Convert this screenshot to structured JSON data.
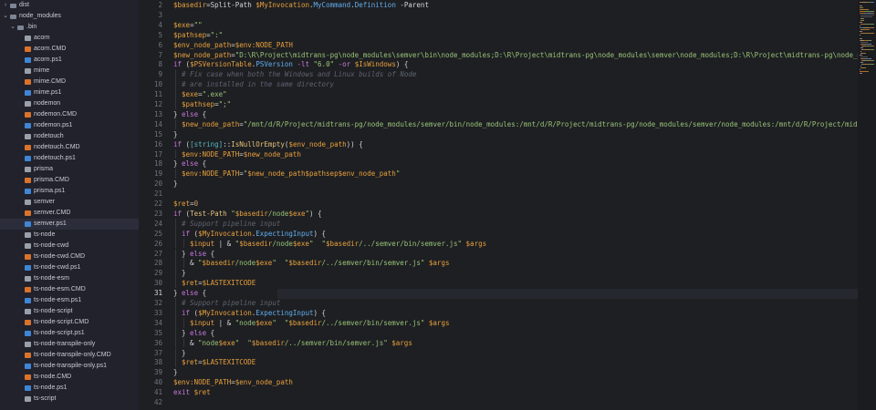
{
  "sidebar": {
    "items": [
      {
        "label": "dist",
        "depth": 0,
        "kind": "folder",
        "chevron": "right"
      },
      {
        "label": "node_modules",
        "depth": 0,
        "kind": "folder",
        "chevron": "down"
      },
      {
        "label": ".bin",
        "depth": 1,
        "kind": "folder",
        "chevron": "down"
      },
      {
        "label": "acorn",
        "depth": 2,
        "kind": "file"
      },
      {
        "label": "acorn.CMD",
        "depth": 2,
        "kind": "cmd"
      },
      {
        "label": "acorn.ps1",
        "depth": 2,
        "kind": "ps1"
      },
      {
        "label": "mime",
        "depth": 2,
        "kind": "file"
      },
      {
        "label": "mime.CMD",
        "depth": 2,
        "kind": "cmd"
      },
      {
        "label": "mime.ps1",
        "depth": 2,
        "kind": "ps1"
      },
      {
        "label": "nodemon",
        "depth": 2,
        "kind": "file"
      },
      {
        "label": "nodemon.CMD",
        "depth": 2,
        "kind": "cmd"
      },
      {
        "label": "nodemon.ps1",
        "depth": 2,
        "kind": "ps1"
      },
      {
        "label": "nodetouch",
        "depth": 2,
        "kind": "file"
      },
      {
        "label": "nodetouch.CMD",
        "depth": 2,
        "kind": "cmd"
      },
      {
        "label": "nodetouch.ps1",
        "depth": 2,
        "kind": "ps1"
      },
      {
        "label": "prisma",
        "depth": 2,
        "kind": "file"
      },
      {
        "label": "prisma.CMD",
        "depth": 2,
        "kind": "cmd"
      },
      {
        "label": "prisma.ps1",
        "depth": 2,
        "kind": "ps1"
      },
      {
        "label": "semver",
        "depth": 2,
        "kind": "file"
      },
      {
        "label": "semver.CMD",
        "depth": 2,
        "kind": "cmd"
      },
      {
        "label": "semver.ps1",
        "depth": 2,
        "kind": "ps1",
        "selected": true
      },
      {
        "label": "ts-node",
        "depth": 2,
        "kind": "file"
      },
      {
        "label": "ts-node-cwd",
        "depth": 2,
        "kind": "file"
      },
      {
        "label": "ts-node-cwd.CMD",
        "depth": 2,
        "kind": "cmd"
      },
      {
        "label": "ts-node-cwd.ps1",
        "depth": 2,
        "kind": "ps1"
      },
      {
        "label": "ts-node-esm",
        "depth": 2,
        "kind": "file"
      },
      {
        "label": "ts-node-esm.CMD",
        "depth": 2,
        "kind": "cmd"
      },
      {
        "label": "ts-node-esm.ps1",
        "depth": 2,
        "kind": "ps1"
      },
      {
        "label": "ts-node-script",
        "depth": 2,
        "kind": "file"
      },
      {
        "label": "ts-node-script.CMD",
        "depth": 2,
        "kind": "cmd"
      },
      {
        "label": "ts-node-script.ps1",
        "depth": 2,
        "kind": "ps1"
      },
      {
        "label": "ts-node-transpile-only",
        "depth": 2,
        "kind": "file"
      },
      {
        "label": "ts-node-transpile-only.CMD",
        "depth": 2,
        "kind": "cmd"
      },
      {
        "label": "ts-node-transpile-only.ps1",
        "depth": 2,
        "kind": "ps1"
      },
      {
        "label": "ts-node.CMD",
        "depth": 2,
        "kind": "cmd"
      },
      {
        "label": "ts-node.ps1",
        "depth": 2,
        "kind": "ps1"
      },
      {
        "label": "ts-script",
        "depth": 2,
        "kind": "file"
      }
    ]
  },
  "editor": {
    "active_line": 31,
    "lines": [
      {
        "n": 2,
        "indent": 0,
        "t": [
          [
            "var",
            "$basedir"
          ],
          [
            "plain",
            "=Split-Path "
          ],
          [
            "var",
            "$MyInvocation"
          ],
          [
            "plain",
            "."
          ],
          [
            "mem",
            "MyCommand"
          ],
          [
            "plain",
            "."
          ],
          [
            "mem",
            "Definition"
          ],
          [
            "plain",
            " -Parent"
          ]
        ]
      },
      {
        "n": 3,
        "indent": 0,
        "t": []
      },
      {
        "n": 4,
        "indent": 0,
        "t": [
          [
            "var",
            "$exe"
          ],
          [
            "plain",
            "="
          ],
          [
            "str",
            "\"\""
          ]
        ]
      },
      {
        "n": 5,
        "indent": 0,
        "t": [
          [
            "var",
            "$pathsep"
          ],
          [
            "plain",
            "="
          ],
          [
            "str",
            "\":\""
          ]
        ]
      },
      {
        "n": 6,
        "indent": 0,
        "t": [
          [
            "var",
            "$env_node_path"
          ],
          [
            "plain",
            "="
          ],
          [
            "var",
            "$env:NODE_PATH"
          ]
        ]
      },
      {
        "n": 7,
        "indent": 0,
        "t": [
          [
            "var",
            "$new_node_path"
          ],
          [
            "plain",
            "="
          ],
          [
            "str",
            "\"D:\\R\\Project\\midtrans-pg\\node_modules\\semver\\bin\\node_modules;D:\\R\\Project\\midtrans-pg\\node_modules\\semver\\node_modules;D:\\R\\Project\\midtrans-pg\\node_m"
          ]
        ]
      },
      {
        "n": 8,
        "indent": 0,
        "t": [
          [
            "kw",
            "if"
          ],
          [
            "plain",
            " ("
          ],
          [
            "var",
            "$PSVersionTable"
          ],
          [
            "plain",
            "."
          ],
          [
            "mem",
            "PSVersion"
          ],
          [
            "plain",
            " "
          ],
          [
            "op",
            "-lt"
          ],
          [
            "plain",
            " "
          ],
          [
            "str",
            "\"6.0\""
          ],
          [
            "plain",
            " "
          ],
          [
            "op",
            "-or"
          ],
          [
            "plain",
            " "
          ],
          [
            "var",
            "$IsWindows"
          ],
          [
            "plain",
            ") {"
          ]
        ]
      },
      {
        "n": 9,
        "indent": 1,
        "t": [
          [
            "cmt",
            "# Fix case when both the Windows and Linux builds of Node"
          ]
        ]
      },
      {
        "n": 10,
        "indent": 1,
        "t": [
          [
            "cmt",
            "# are installed in the same directory"
          ]
        ]
      },
      {
        "n": 11,
        "indent": 1,
        "t": [
          [
            "var",
            "$exe"
          ],
          [
            "plain",
            "="
          ],
          [
            "str",
            "\".exe\""
          ]
        ]
      },
      {
        "n": 12,
        "indent": 1,
        "t": [
          [
            "var",
            "$pathsep"
          ],
          [
            "plain",
            "="
          ],
          [
            "str",
            "\";\""
          ]
        ]
      },
      {
        "n": 13,
        "indent": 0,
        "t": [
          [
            "plain",
            "} "
          ],
          [
            "kw",
            "else"
          ],
          [
            "plain",
            " {"
          ]
        ]
      },
      {
        "n": 14,
        "indent": 1,
        "t": [
          [
            "var",
            "$new_node_path"
          ],
          [
            "plain",
            "="
          ],
          [
            "str",
            "\"/mnt/d/R/Project/midtrans-pg/node_modules/semver/bin/node_modules:/mnt/d/R/Project/midtrans-pg/node_modules/semver/node_modules:/mnt/d/R/Project/midt"
          ]
        ]
      },
      {
        "n": 15,
        "indent": 0,
        "t": [
          [
            "plain",
            "}"
          ]
        ]
      },
      {
        "n": 16,
        "indent": 0,
        "t": [
          [
            "kw",
            "if"
          ],
          [
            "plain",
            " ("
          ],
          [
            "type",
            "[string]"
          ],
          [
            "plain",
            "::"
          ],
          [
            "fn",
            "IsNullOrEmpty"
          ],
          [
            "plain",
            "("
          ],
          [
            "var",
            "$env_node_path"
          ],
          [
            "plain",
            ")) {"
          ]
        ]
      },
      {
        "n": 17,
        "indent": 1,
        "t": [
          [
            "var",
            "$env:NODE_PATH"
          ],
          [
            "plain",
            "="
          ],
          [
            "var",
            "$new_node_path"
          ]
        ]
      },
      {
        "n": 18,
        "indent": 0,
        "t": [
          [
            "plain",
            "} "
          ],
          [
            "kw",
            "else"
          ],
          [
            "plain",
            " {"
          ]
        ]
      },
      {
        "n": 19,
        "indent": 1,
        "t": [
          [
            "var",
            "$env:NODE_PATH"
          ],
          [
            "plain",
            "="
          ],
          [
            "str",
            "\""
          ],
          [
            "var",
            "$new_node_path$pathsep$env_node_path"
          ],
          [
            "str",
            "\""
          ]
        ]
      },
      {
        "n": 20,
        "indent": 0,
        "t": [
          [
            "plain",
            "}"
          ]
        ]
      },
      {
        "n": 21,
        "indent": 0,
        "t": []
      },
      {
        "n": 22,
        "indent": 0,
        "t": [
          [
            "var",
            "$ret"
          ],
          [
            "plain",
            "="
          ],
          [
            "num",
            "0"
          ]
        ]
      },
      {
        "n": 23,
        "indent": 0,
        "t": [
          [
            "kw",
            "if"
          ],
          [
            "plain",
            " ("
          ],
          [
            "fn",
            "Test-Path"
          ],
          [
            "plain",
            " "
          ],
          [
            "str",
            "\""
          ],
          [
            "var",
            "$basedir"
          ],
          [
            "str",
            "/node"
          ],
          [
            "var",
            "$exe"
          ],
          [
            "str",
            "\""
          ],
          [
            "plain",
            ") {"
          ]
        ]
      },
      {
        "n": 24,
        "indent": 1,
        "t": [
          [
            "cmt",
            "# Support pipeline input"
          ]
        ]
      },
      {
        "n": 25,
        "indent": 1,
        "t": [
          [
            "kw",
            "if"
          ],
          [
            "plain",
            " ("
          ],
          [
            "var",
            "$MyInvocation"
          ],
          [
            "plain",
            "."
          ],
          [
            "mem",
            "ExpectingInput"
          ],
          [
            "plain",
            ") {"
          ]
        ]
      },
      {
        "n": 26,
        "indent": 2,
        "t": [
          [
            "var",
            "$input"
          ],
          [
            "plain",
            " | & "
          ],
          [
            "str",
            "\""
          ],
          [
            "var",
            "$basedir"
          ],
          [
            "str",
            "/node"
          ],
          [
            "var",
            "$exe"
          ],
          [
            "str",
            "\""
          ],
          [
            "plain",
            "  "
          ],
          [
            "str",
            "\""
          ],
          [
            "var",
            "$basedir"
          ],
          [
            "str",
            "/../semver/bin/semver.js\""
          ],
          [
            "plain",
            " "
          ],
          [
            "var",
            "$args"
          ]
        ]
      },
      {
        "n": 27,
        "indent": 1,
        "t": [
          [
            "plain",
            "} "
          ],
          [
            "kw",
            "else"
          ],
          [
            "plain",
            " {"
          ]
        ]
      },
      {
        "n": 28,
        "indent": 2,
        "t": [
          [
            "plain",
            "& "
          ],
          [
            "str",
            "\""
          ],
          [
            "var",
            "$basedir"
          ],
          [
            "str",
            "/node"
          ],
          [
            "var",
            "$exe"
          ],
          [
            "str",
            "\""
          ],
          [
            "plain",
            "  "
          ],
          [
            "str",
            "\""
          ],
          [
            "var",
            "$basedir"
          ],
          [
            "str",
            "/../semver/bin/semver.js\""
          ],
          [
            "plain",
            " "
          ],
          [
            "var",
            "$args"
          ]
        ]
      },
      {
        "n": 29,
        "indent": 1,
        "t": [
          [
            "plain",
            "}"
          ]
        ]
      },
      {
        "n": 30,
        "indent": 1,
        "t": [
          [
            "var",
            "$ret"
          ],
          [
            "plain",
            "="
          ],
          [
            "var",
            "$LASTEXITCODE"
          ]
        ]
      },
      {
        "n": 31,
        "indent": 0,
        "t": [
          [
            "plain",
            "} "
          ],
          [
            "kw",
            "else"
          ],
          [
            "plain",
            " {"
          ]
        ]
      },
      {
        "n": 32,
        "indent": 1,
        "t": [
          [
            "cmt",
            "# Support pipeline input"
          ]
        ]
      },
      {
        "n": 33,
        "indent": 1,
        "t": [
          [
            "kw",
            "if"
          ],
          [
            "plain",
            " ("
          ],
          [
            "var",
            "$MyInvocation"
          ],
          [
            "plain",
            "."
          ],
          [
            "mem",
            "ExpectingInput"
          ],
          [
            "plain",
            ") {"
          ]
        ]
      },
      {
        "n": 34,
        "indent": 2,
        "t": [
          [
            "var",
            "$input"
          ],
          [
            "plain",
            " | & "
          ],
          [
            "str",
            "\"node"
          ],
          [
            "var",
            "$exe"
          ],
          [
            "str",
            "\""
          ],
          [
            "plain",
            "  "
          ],
          [
            "str",
            "\""
          ],
          [
            "var",
            "$basedir"
          ],
          [
            "str",
            "/../semver/bin/semver.js\""
          ],
          [
            "plain",
            " "
          ],
          [
            "var",
            "$args"
          ]
        ]
      },
      {
        "n": 35,
        "indent": 1,
        "t": [
          [
            "plain",
            "} "
          ],
          [
            "kw",
            "else"
          ],
          [
            "plain",
            " {"
          ]
        ]
      },
      {
        "n": 36,
        "indent": 2,
        "t": [
          [
            "plain",
            "& "
          ],
          [
            "str",
            "\"node"
          ],
          [
            "var",
            "$exe"
          ],
          [
            "str",
            "\""
          ],
          [
            "plain",
            "  "
          ],
          [
            "str",
            "\""
          ],
          [
            "var",
            "$basedir"
          ],
          [
            "str",
            "/../semver/bin/semver.js\""
          ],
          [
            "plain",
            " "
          ],
          [
            "var",
            "$args"
          ]
        ]
      },
      {
        "n": 37,
        "indent": 1,
        "t": [
          [
            "plain",
            "}"
          ]
        ]
      },
      {
        "n": 38,
        "indent": 1,
        "t": [
          [
            "var",
            "$ret"
          ],
          [
            "plain",
            "="
          ],
          [
            "var",
            "$LASTEXITCODE"
          ]
        ]
      },
      {
        "n": 39,
        "indent": 0,
        "t": [
          [
            "plain",
            "}"
          ]
        ]
      },
      {
        "n": 40,
        "indent": 0,
        "t": [
          [
            "var",
            "$env:NODE_PATH"
          ],
          [
            "plain",
            "="
          ],
          [
            "var",
            "$env_node_path"
          ]
        ]
      },
      {
        "n": 41,
        "indent": 0,
        "t": [
          [
            "kw",
            "exit"
          ],
          [
            "plain",
            " "
          ],
          [
            "var",
            "$ret"
          ]
        ]
      },
      {
        "n": 42,
        "indent": 0,
        "t": []
      }
    ]
  },
  "colors": {
    "background": "#1e1f22",
    "sidebar": "#21222c",
    "variable": "#e8a03d",
    "string": "#98c379",
    "keyword": "#c678dd",
    "comment": "#5c6370"
  }
}
